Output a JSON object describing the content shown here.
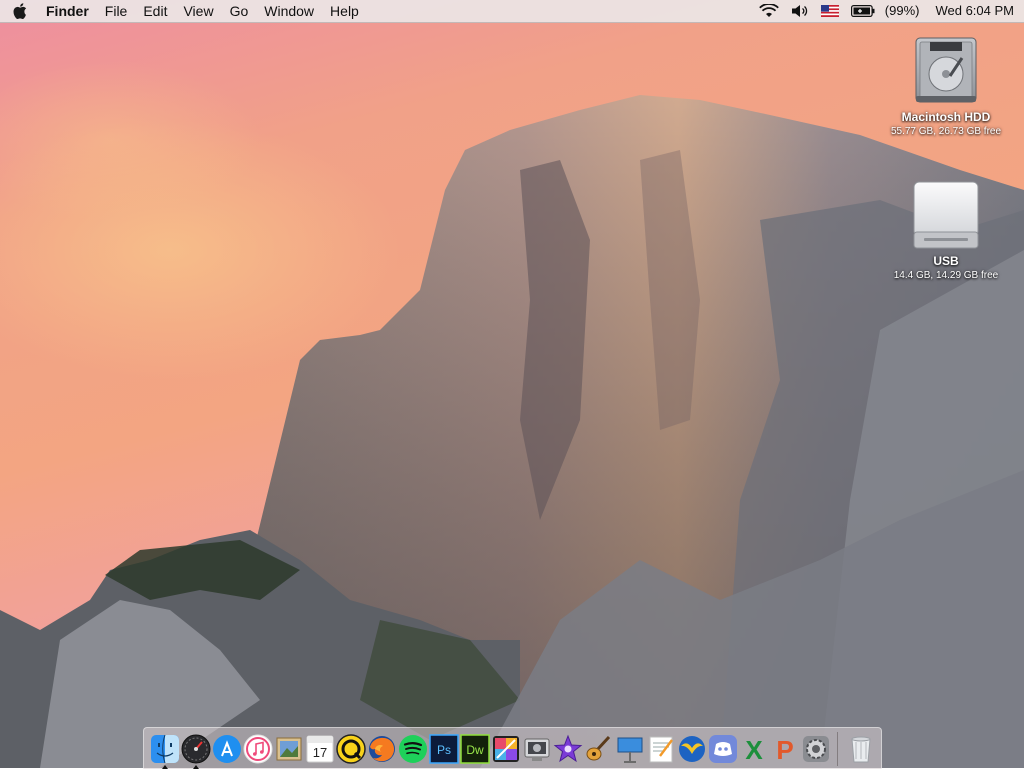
{
  "menubar": {
    "app_name": "Finder",
    "menus": [
      "File",
      "Edit",
      "View",
      "Go",
      "Window",
      "Help"
    ],
    "battery_text": "(99%)",
    "clock": "Wed 6:04 PM",
    "status_icons": [
      "wifi-icon",
      "volume-icon",
      "us-flag-input-icon",
      "battery-icon"
    ]
  },
  "desktop": {
    "icons": [
      {
        "name": "Macintosh HDD",
        "info": "55.77 GB, 26.73 GB free",
        "icon": "internal-hard-drive-icon"
      },
      {
        "name": "USB",
        "info": "14.4 GB, 14.29 GB free",
        "icon": "external-drive-icon"
      }
    ]
  },
  "dock": {
    "running": [
      "finder-icon",
      "dashboard-icon"
    ],
    "apps": [
      "finder-icon",
      "dashboard-icon",
      "app-store-icon",
      "itunes-icon",
      "preview-icon",
      "calendar-icon",
      "quicktime-icon",
      "firefox-icon",
      "spotify-icon",
      "photoshop-icon",
      "dreamweaver-icon",
      "final-cut-icon",
      "screenshot-icon",
      "imovie-icon",
      "garageband-icon",
      "keynote-icon",
      "pages-icon",
      "wings-icon",
      "discord-icon",
      "excel-icon",
      "powerpoint-icon",
      "system-preferences-icon",
      "trash-icon"
    ],
    "calendar_day": "17",
    "labels": {
      "photoshop": "Ps",
      "dreamweaver": "Dw",
      "excel": "X",
      "powerpoint": "P"
    }
  },
  "colors": {
    "sky_top": "#f08aa0",
    "sky_mid": "#f3a07e",
    "rock": "#8d8f97",
    "menubar": "#ece6e6"
  }
}
